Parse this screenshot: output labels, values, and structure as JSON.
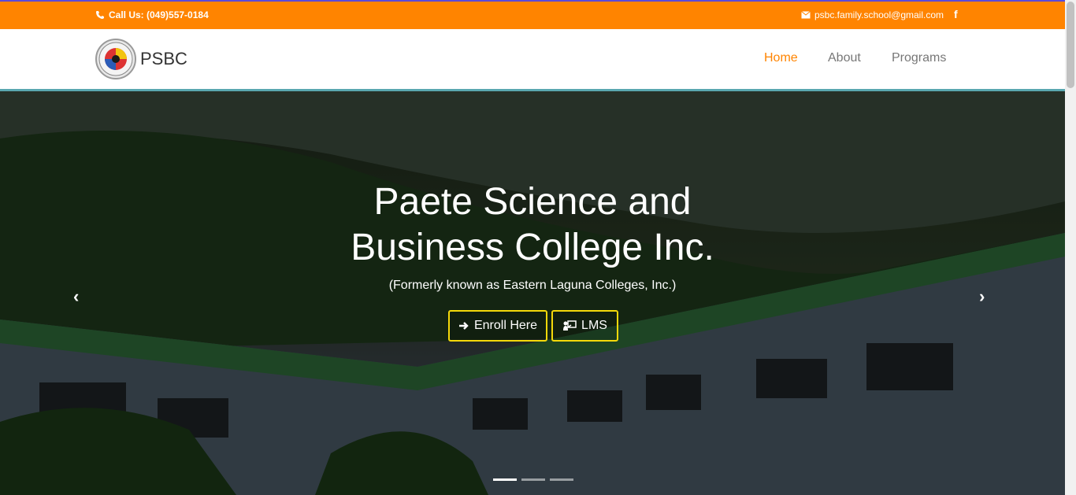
{
  "topbar": {
    "call_text": "Call Us: (049)557-0184",
    "email": "psbc.family.school@gmail.com",
    "facebook_icon": "f",
    "phone_icon": "phone-icon",
    "mail_icon": "envelope-icon"
  },
  "header": {
    "brand": "PSBC",
    "nav": {
      "home": "Home",
      "about": "About",
      "programs": "Programs"
    }
  },
  "hero": {
    "title_line1": "Paete Science and",
    "title_line2": "Business College Inc.",
    "subtitle": "(Formerly known as Eastern Laguna Colleges, Inc.)",
    "enroll_label": "Enroll Here",
    "lms_label": "LMS",
    "prev": "‹",
    "next": "›",
    "active_slide": 1,
    "slide_count": 3
  },
  "colors": {
    "accent": "#ff8400",
    "button_border": "#f5d90a",
    "header_border": "#5aa7b0"
  }
}
